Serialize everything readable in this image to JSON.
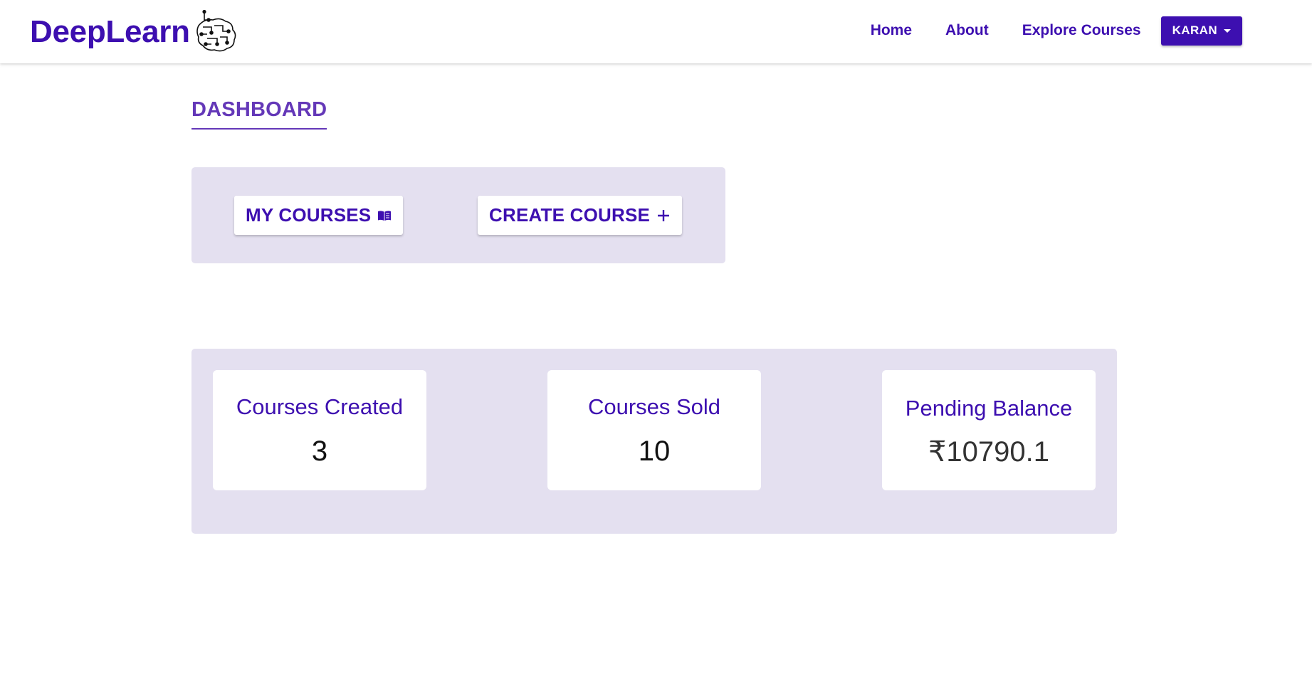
{
  "brand": {
    "name": "DeepLearn",
    "logo_icon": "circuit-brain-icon",
    "color": "#3d0fb0"
  },
  "nav": {
    "links": [
      "Home",
      "About",
      "Explore Courses"
    ],
    "user_menu_label": "KARAN",
    "user_menu_icon": "caret-down-icon"
  },
  "dashboard": {
    "title": "DASHBOARD",
    "actions": {
      "my_courses_label": "MY COURSES",
      "my_courses_icon": "book-icon",
      "create_course_label": "CREATE COURSE",
      "create_course_icon": "plus-icon"
    },
    "stats": [
      {
        "label": "Courses Created",
        "value": "3"
      },
      {
        "label": "Courses Sold",
        "value": "10"
      },
      {
        "label": "Pending Balance",
        "value": "₹10790.1"
      }
    ]
  },
  "colors": {
    "primary": "#3d0fb0",
    "title_accent": "#6438b8",
    "panel_background": "#e4e0f0",
    "card_background": "#ffffff"
  }
}
